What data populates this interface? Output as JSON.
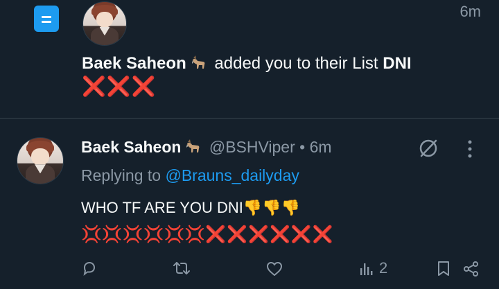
{
  "notification": {
    "time": "6m",
    "user_name": "Baek Saheon",
    "emoji": "🐐",
    "action_text": "added you to their List",
    "list_name": "DNI",
    "list_name_extra": "❌❌❌"
  },
  "tweet": {
    "user_name": "Baek Saheon",
    "emoji": "🐐",
    "handle": "@BSHViper",
    "dot": "•",
    "time": "6m",
    "replying_label": "Replying to",
    "replying_to": "@Brauns_dailyday",
    "text_line1": "WHO TF ARE YOU DNI👎👎👎",
    "text_line2_anger": "💢💢💢💢💢💢",
    "text_line2_x": "❌❌❌❌❌❌",
    "views_count": "2"
  },
  "icons": {
    "list": "list-icon",
    "grok": "grok-icon",
    "more": "more-vertical-icon",
    "reply": "reply-icon",
    "retweet": "retweet-icon",
    "like": "like-icon",
    "views": "views-icon",
    "bookmark": "bookmark-icon",
    "share": "share-icon"
  },
  "colors": {
    "background": "#15202b",
    "accent": "#1d9bf0",
    "muted": "#8b98a5",
    "divider": "#38444d"
  }
}
